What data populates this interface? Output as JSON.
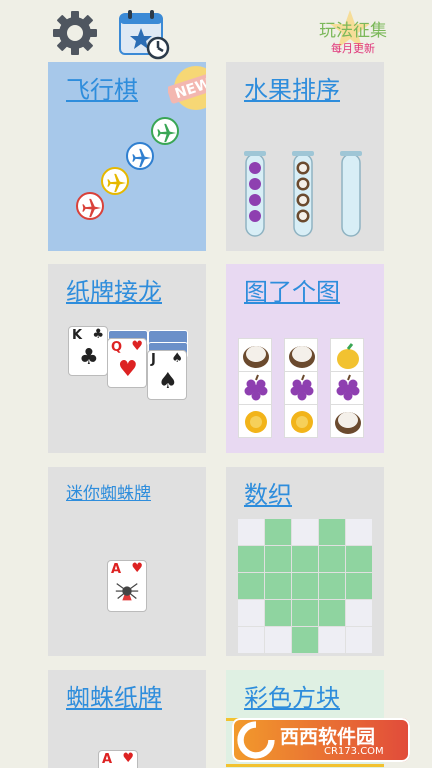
{
  "header": {
    "promo_title": "玩法征集",
    "promo_subtitle": "每月更新"
  },
  "games": [
    {
      "title": "飞行棋",
      "badge": "NEW!"
    },
    {
      "title": "水果排序"
    },
    {
      "title": "纸牌接龙",
      "cards": [
        {
          "rank": "K",
          "suit": "♣"
        },
        {
          "rank": "Q",
          "suit": "♥"
        },
        {
          "rank": "J",
          "suit": "♠"
        }
      ]
    },
    {
      "title": "图了个图"
    },
    {
      "title": "迷你蜘蛛牌",
      "cards": [
        {
          "rank": "A",
          "suit": "♥"
        }
      ]
    },
    {
      "title": "数织"
    },
    {
      "title": "蜘蛛纸牌",
      "cards": [
        {
          "rank": "A",
          "suit": "♥"
        }
      ]
    },
    {
      "title": "彩色方块"
    }
  ],
  "watermark": {
    "brand": "西西软件园",
    "url": "CR173.COM"
  },
  "colors": {
    "title_link": "#2e8ddc",
    "nonogram_fill": "#8fd4a0",
    "nonogram_empty": "#eeeef4"
  }
}
